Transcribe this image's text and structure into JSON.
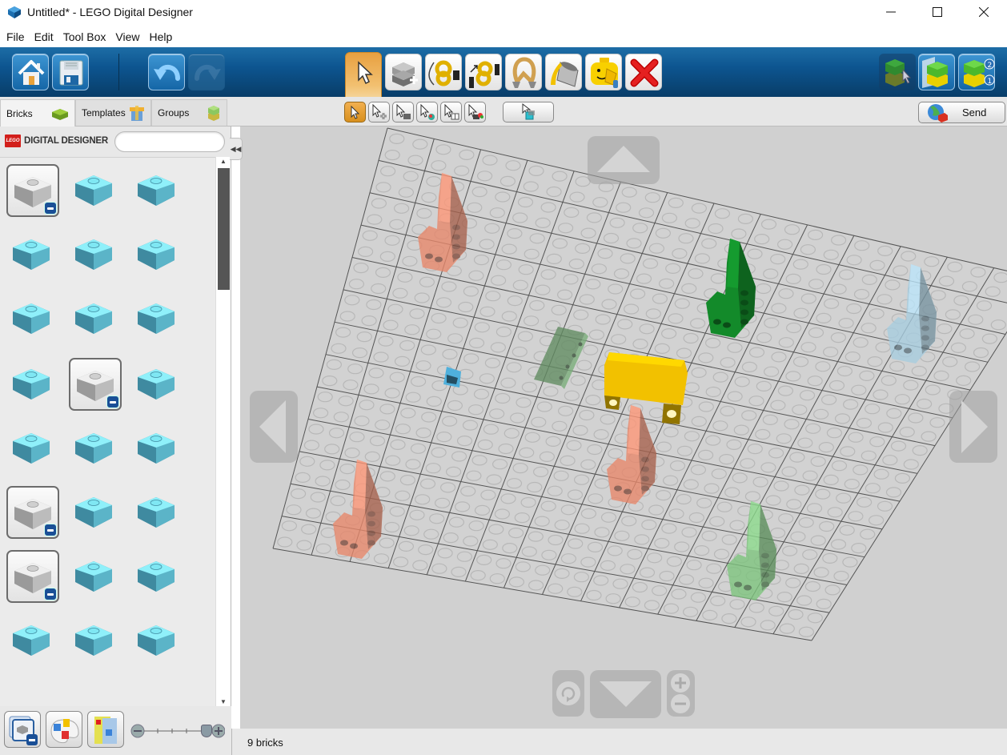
{
  "window": {
    "title": "Untitled* - LEGO Digital Designer",
    "controls": [
      "minimize",
      "maximize",
      "close"
    ]
  },
  "menu": [
    "File",
    "Edit",
    "Tool Box",
    "View",
    "Help"
  ],
  "toolbar": {
    "left": [
      {
        "name": "home",
        "icon": "house-icon",
        "enabled": true
      },
      {
        "name": "save",
        "icon": "floppy-disk-icon",
        "enabled": true
      },
      {
        "name": "undo",
        "icon": "undo-arrow-icon",
        "enabled": true
      },
      {
        "name": "redo",
        "icon": "redo-arrow-icon",
        "enabled": false
      }
    ],
    "tools": [
      {
        "name": "select",
        "icon": "cursor-icon",
        "active": true
      },
      {
        "name": "clone",
        "icon": "clone-brick-icon",
        "active": false
      },
      {
        "name": "hinge",
        "icon": "hinge-icon",
        "active": false
      },
      {
        "name": "hinge-align",
        "icon": "hinge-align-icon",
        "active": false
      },
      {
        "name": "flex",
        "icon": "flex-rope-icon",
        "active": false
      },
      {
        "name": "paint",
        "icon": "paint-bucket-icon",
        "active": false
      },
      {
        "name": "decoration",
        "icon": "minifig-head-icon",
        "active": false
      },
      {
        "name": "delete",
        "icon": "red-x-icon",
        "active": false
      }
    ],
    "modes": [
      {
        "name": "build-mode",
        "icon": "build-mode-icon",
        "active": false
      },
      {
        "name": "view-mode",
        "icon": "view-mode-icon",
        "active": true
      },
      {
        "name": "building-guide-mode",
        "icon": "building-guide-icon",
        "active": true
      }
    ]
  },
  "tabs": [
    {
      "label": "Bricks",
      "active": true
    },
    {
      "label": "Templates",
      "active": false
    },
    {
      "label": "Groups",
      "active": false
    }
  ],
  "select_tools": [
    "single-select",
    "multi-select",
    "select-same-shape",
    "select-same-color",
    "select-same-shape-color",
    "invert-select"
  ],
  "send_label": "Send",
  "brand_text": "DIGITAL DESIGNER",
  "brand_logo": "LEGO",
  "search": {
    "value": "",
    "placeholder": ""
  },
  "palette": {
    "brick_color": "#7fe7f3",
    "items": [
      {
        "name": "brick-2x4-group",
        "framed": true
      },
      {
        "name": "brick-1x1",
        "framed": false
      },
      {
        "name": "brick-1x2",
        "framed": false
      },
      {
        "name": "brick-corner-1x2x2",
        "framed": false
      },
      {
        "name": "brick-2x2",
        "framed": false
      },
      {
        "name": "brick-1x4",
        "framed": false
      },
      {
        "name": "brick-1x1-tall",
        "framed": false
      },
      {
        "name": "brick-1x6",
        "framed": false
      },
      {
        "name": "brick-2x4",
        "framed": false
      },
      {
        "name": "plate-2x6",
        "framed": false
      },
      {
        "name": "round-brick-group",
        "framed": true
      },
      {
        "name": "round-brick-1x1",
        "framed": false
      },
      {
        "name": "dome-2x2",
        "framed": false
      },
      {
        "name": "arch-round-corner",
        "framed": false
      },
      {
        "name": "round-plate-corner",
        "framed": false
      },
      {
        "name": "brick-with-stud-group",
        "framed": true
      },
      {
        "name": "brick-1x1-side-stud",
        "framed": false
      },
      {
        "name": "brick-1x1-headlight",
        "framed": false
      },
      {
        "name": "slope-group",
        "framed": true
      },
      {
        "name": "slope-2x2",
        "framed": false
      },
      {
        "name": "slope-1x2",
        "framed": false
      },
      {
        "name": "slope-inverted-2x2",
        "framed": false
      },
      {
        "name": "slope-1x3",
        "framed": false
      },
      {
        "name": "slope-inverted-1x3",
        "framed": false
      }
    ]
  },
  "zoom_slider": {
    "value": 1.0
  },
  "scene": {
    "bricks": [
      {
        "name": "brick-salmon-top-left",
        "color": "#e8876a",
        "transparent": true
      },
      {
        "name": "brick-dark-green",
        "color": "#138a2a",
        "transparent": false
      },
      {
        "name": "brick-light-blue-right",
        "color": "#a7cde0",
        "transparent": true
      },
      {
        "name": "brick-green-flat",
        "color": "#6c9b6c",
        "transparent": true
      },
      {
        "name": "brick-small-blue",
        "color": "#4fb0dc",
        "transparent": false
      },
      {
        "name": "brick-yellow",
        "color": "#f2c100",
        "transparent": false
      },
      {
        "name": "brick-salmon-center",
        "color": "#e8876a",
        "transparent": true
      },
      {
        "name": "brick-salmon-bottom-left",
        "color": "#e8876a",
        "transparent": true
      },
      {
        "name": "brick-light-green",
        "color": "#7dc47d",
        "transparent": true
      }
    ]
  },
  "camera_controls": [
    "pan-up",
    "pan-left",
    "pan-right",
    "pan-down",
    "reset-view",
    "zoom-in",
    "zoom-out"
  ],
  "status": {
    "brick_count": "9 bricks"
  }
}
